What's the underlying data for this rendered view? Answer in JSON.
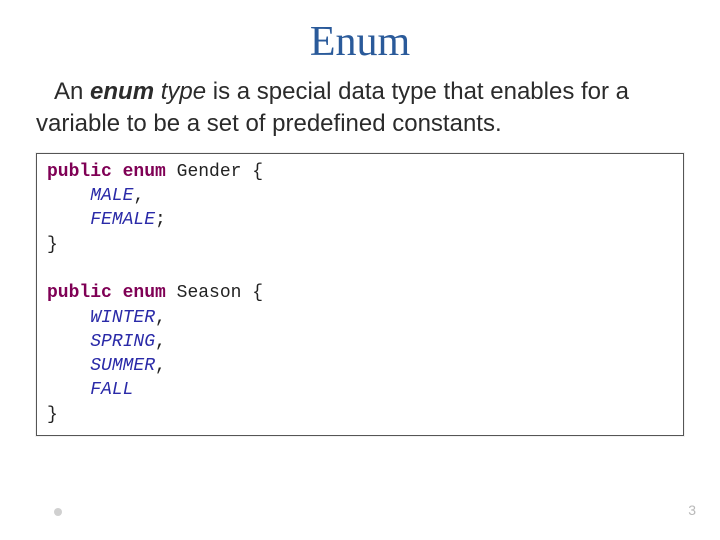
{
  "title": "Enum",
  "desc": {
    "lead": "An ",
    "kw": "enum",
    "mid": " type",
    "rest": " is a special data type that enables for a variable to be a set of predefined constants."
  },
  "code": {
    "l1_kw1": "public",
    "l1_kw2": "enum",
    "l1_name": " Gender {",
    "l2": "MALE",
    "l2_sep": ",",
    "l3": "FEMALE",
    "l3_sep": ";",
    "l4": "}",
    "l6_kw1": "public",
    "l6_kw2": "enum",
    "l6_name": " Season {",
    "l7": "WINTER",
    "l7_sep": ",",
    "l8": "SPRING",
    "l8_sep": ",",
    "l9": "SUMMER",
    "l9_sep": ",",
    "l10": "FALL",
    "l11": "}"
  },
  "pagenum": "3"
}
